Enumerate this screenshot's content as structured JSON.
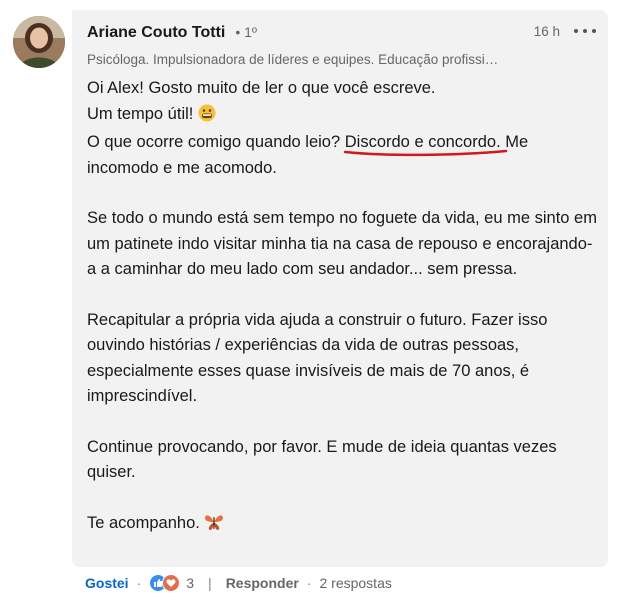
{
  "comment": {
    "author": {
      "name": "Ariane Couto Totti",
      "degree": "• 1º",
      "headline": "Psicóloga. Impulsionadora de líderes e equipes. Educação profissi…"
    },
    "timestamp": "16 h",
    "body": {
      "p1_line1": "Oi Alex! Gosto muito de ler o que você escreve.",
      "p1_line2": "Um tempo útil!",
      "p1_line3_prefix": "O que ocorre comigo quando leio? ",
      "p1_highlight": "Discordo e concordo",
      "p1_line3_suffix": ". Me incomodo e me acomodo.",
      "p2": "Se todo o mundo está sem tempo no foguete da vida, eu me sinto em um patinete indo visitar minha tia na casa de repouso e encorajando-a a caminhar do meu lado com seu andador... sem pressa.",
      "p3": "Recapitular a própria vida ajuda a construir o futuro. Fazer isso ouvindo histórias / experiências da vida de outras pessoas, especialmente esses quase invisíveis de mais de 70 anos, é imprescindível.",
      "p4": "Continue provocando, por favor. E mude de ideia quantas vezes quiser.",
      "p5": "Te acompanho."
    }
  },
  "actions": {
    "like_label": "Gostei",
    "reaction_count": "3",
    "reply_label": "Responder",
    "replies_label": "2 respostas"
  },
  "icons": {
    "grin_emoji": "grinning-face-icon",
    "butterfly": "butterfly-icon",
    "more": "more-options-icon",
    "reaction_like": "like-reaction-icon",
    "reaction_love": "love-reaction-icon"
  },
  "colors": {
    "accent": "#0a66c2",
    "annotation_underline": "#d11a1a",
    "bubble_bg": "#f2f2f2"
  }
}
